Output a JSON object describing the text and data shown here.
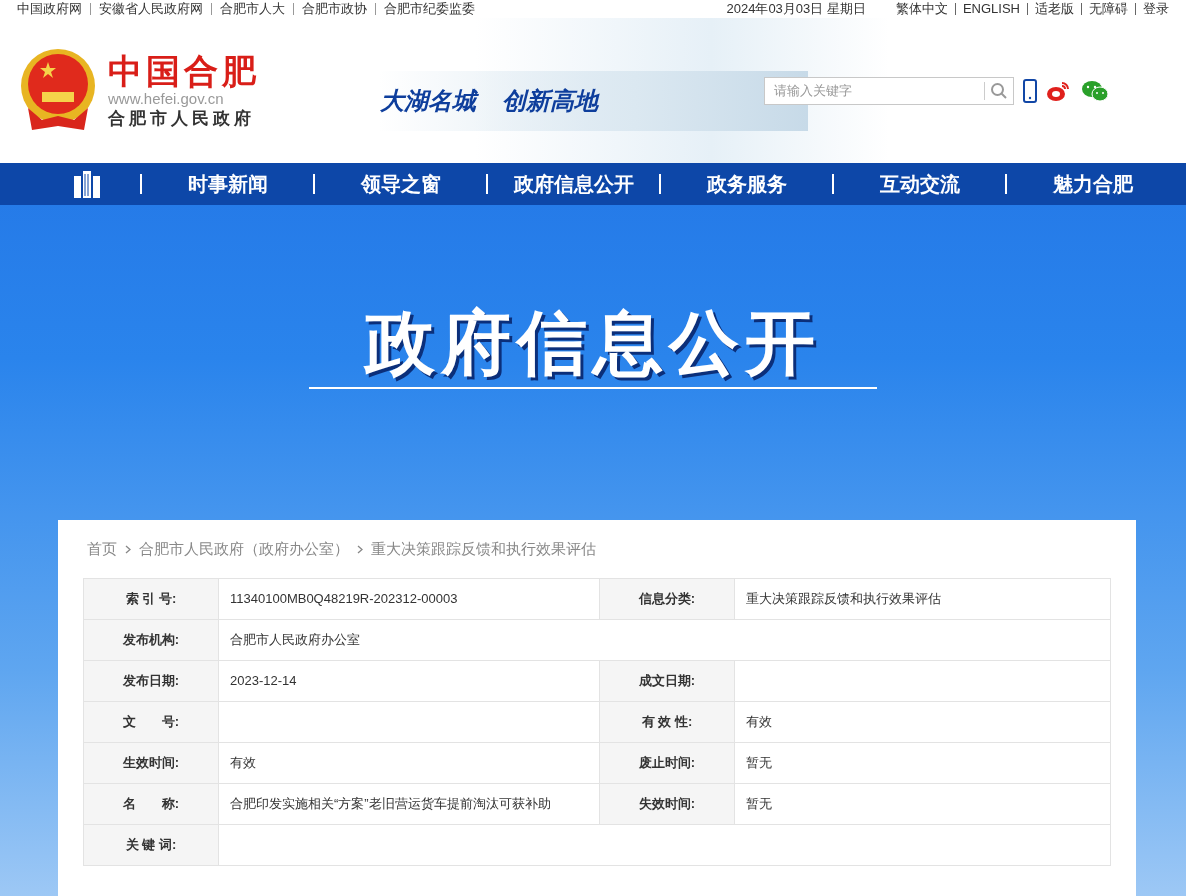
{
  "top_bar": {
    "links": [
      "中国政府网",
      "安徽省人民政府网",
      "合肥市人大",
      "合肥市政协",
      "合肥市纪委监委"
    ],
    "date": "2024年03月03日 星期日",
    "right_links": [
      "繁体中文",
      "ENGLISH",
      "适老版",
      "无障碍",
      "登录"
    ]
  },
  "header": {
    "title": "中国合肥",
    "url": "www.hefei.gov.cn",
    "subtitle": "合肥市人民政府",
    "slogan": [
      "大湖名城",
      "创新高地"
    ],
    "search": {
      "placeholder": "请输入关键字"
    }
  },
  "nav": {
    "items": [
      "时事新闻",
      "领导之窗",
      "政府信息公开",
      "政务服务",
      "互动交流",
      "魅力合肥"
    ]
  },
  "banner": {
    "title": "政府信息公开"
  },
  "breadcrumb": [
    "首页",
    "合肥市人民政府（政府办公室）",
    "重大决策跟踪反馈和执行效果评估"
  ],
  "table": {
    "rows": [
      {
        "cells": [
          {
            "label": "索 引 号:",
            "value": "11340100MB0Q48219R-202312-00003"
          },
          {
            "label": "信息分类:",
            "value": "重大决策跟踪反馈和执行效果评估"
          }
        ]
      },
      {
        "cells": [
          {
            "label": "发布机构:",
            "value": "合肥市人民政府办公室"
          }
        ]
      },
      {
        "cells": [
          {
            "label": "发布日期:",
            "value": "2023-12-14"
          },
          {
            "label": "成文日期:"
          }
        ]
      },
      {
        "cells": [
          {
            "label": "文　　号:"
          },
          {
            "label": "有 效 性:",
            "value": "有效"
          }
        ]
      },
      {
        "cells": [
          {
            "label": "生效时间:",
            "value": "有效"
          },
          {
            "label": "废止时间:",
            "value": "暂无"
          }
        ]
      },
      {
        "cells": [
          {
            "label": "名　　称:",
            "value": "合肥印发实施相关“方案”老旧营运货车提前淘汰可获补助"
          },
          {
            "label": "失效时间:",
            "value": "暂无"
          }
        ]
      },
      {
        "cells": [
          {
            "label": "关 键 词:"
          }
        ]
      }
    ]
  }
}
